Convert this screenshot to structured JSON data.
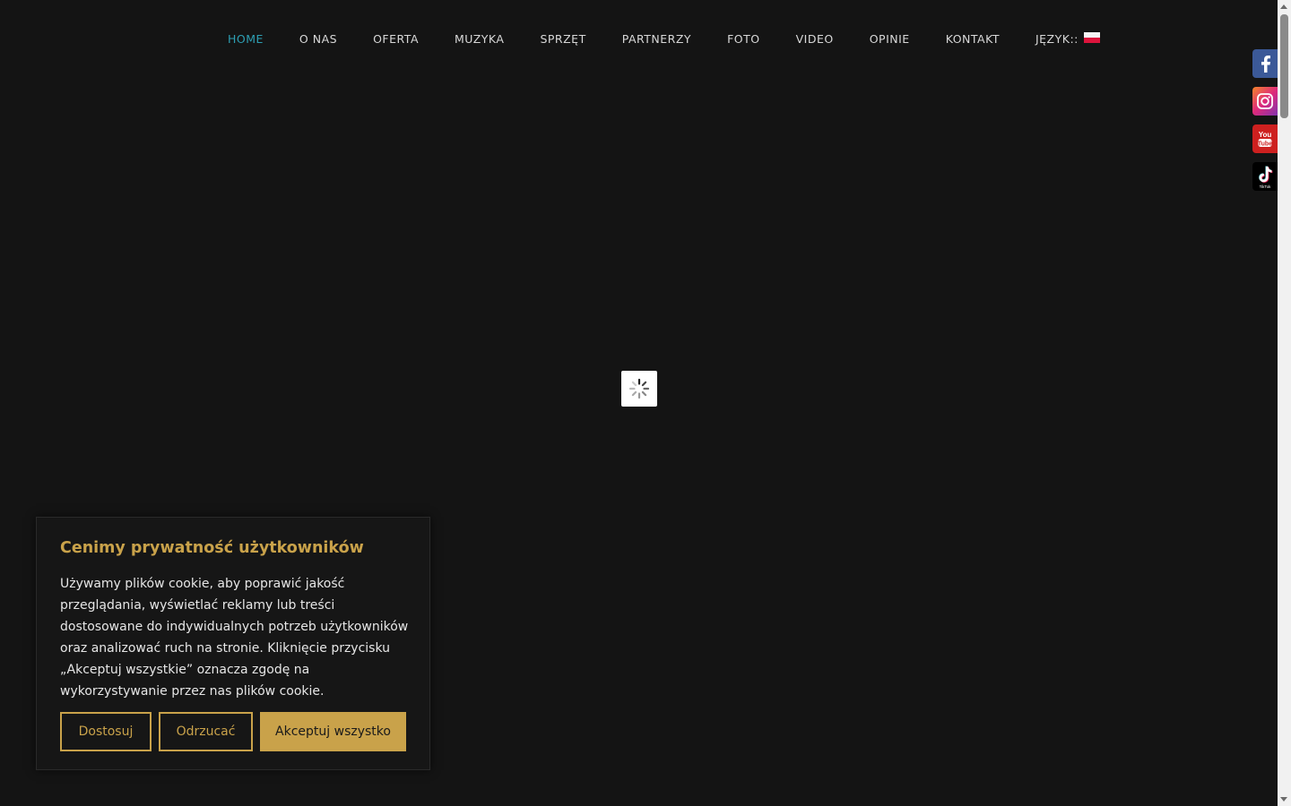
{
  "nav": {
    "items": [
      {
        "label": "HOME",
        "active": true
      },
      {
        "label": "O NAS"
      },
      {
        "label": "OFERTA"
      },
      {
        "label": "MUZYKA"
      },
      {
        "label": "SPRZĘT"
      },
      {
        "label": "PARTNERZY"
      },
      {
        "label": "FOTO"
      },
      {
        "label": "VIDEO"
      },
      {
        "label": "OPINIE"
      },
      {
        "label": "KONTAKT"
      }
    ],
    "language_label": "JĘZYK::",
    "language_flag_icon": "poland-flag-icon"
  },
  "loader": {
    "icon": "loading-spinner-icon"
  },
  "social": [
    {
      "icon": "facebook-icon",
      "color": "#3b5998"
    },
    {
      "icon": "instagram-icon",
      "color": "#c13584"
    },
    {
      "icon": "youtube-icon",
      "color": "#cd201f"
    },
    {
      "icon": "tiktok-icon",
      "color": "#000000",
      "caption": "TikTok"
    }
  ],
  "cookie": {
    "title": "Cenimy prywatność użytkowników",
    "text": "Używamy plików cookie, aby poprawić jakość przeglądania, wyświetlać reklamy lub treści dostosowane do indywidualnych potrzeb użytkowników oraz analizować ruch na stronie. Kliknięcie przycisku „Akceptuj wszystkie” oznacza zgodę na wykorzystywanie przez nas plików cookie.",
    "customize_label": "Dostosuj",
    "reject_label": "Odrzucać",
    "accept_label": "Akceptuj wszystko"
  },
  "colors": {
    "background": "#141414",
    "accent_gold": "#c9a24a",
    "active_nav": "#2d9fb3",
    "nav_text": "#d8d8d8"
  }
}
